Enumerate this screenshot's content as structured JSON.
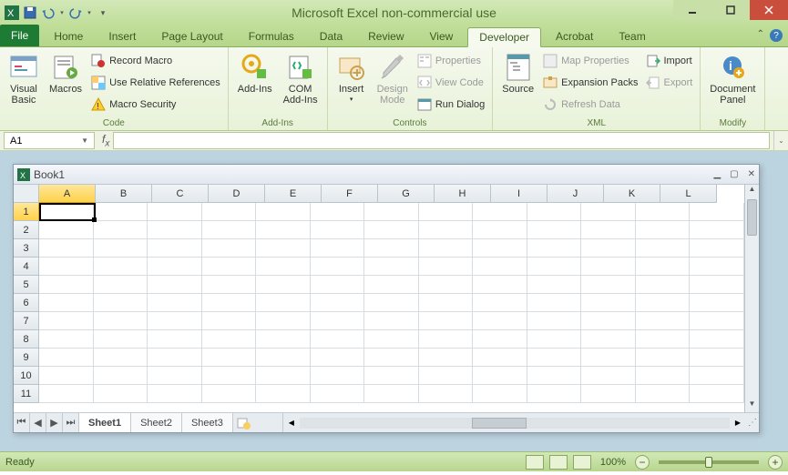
{
  "title": "Microsoft Excel non-commercial use",
  "tabs": {
    "file": "File",
    "home": "Home",
    "insert": "Insert",
    "pagelayout": "Page Layout",
    "formulas": "Formulas",
    "data": "Data",
    "review": "Review",
    "view": "View",
    "developer": "Developer",
    "acrobat": "Acrobat",
    "team": "Team"
  },
  "ribbon": {
    "code": {
      "visual_basic": "Visual\nBasic",
      "macros": "Macros",
      "record_macro": "Record Macro",
      "use_relative": "Use Relative References",
      "macro_security": "Macro Security",
      "group": "Code"
    },
    "addins": {
      "addins": "Add-Ins",
      "com_addins": "COM\nAdd-Ins",
      "group": "Add-Ins"
    },
    "controls": {
      "insert": "Insert",
      "design_mode": "Design\nMode",
      "properties": "Properties",
      "view_code": "View Code",
      "run_dialog": "Run Dialog",
      "group": "Controls"
    },
    "xml": {
      "source": "Source",
      "map_properties": "Map Properties",
      "expansion_packs": "Expansion Packs",
      "refresh_data": "Refresh Data",
      "import": "Import",
      "export": "Export",
      "group": "XML"
    },
    "modify": {
      "document_panel": "Document\nPanel",
      "group": "Modify"
    }
  },
  "namebox": "A1",
  "workbook": {
    "title": "Book1",
    "columns": [
      "A",
      "B",
      "C",
      "D",
      "E",
      "F",
      "G",
      "H",
      "I",
      "J",
      "K",
      "L"
    ],
    "rows": [
      "1",
      "2",
      "3",
      "4",
      "5",
      "6",
      "7",
      "8",
      "9",
      "10",
      "11"
    ],
    "active_col": "A",
    "active_row": "1",
    "sheets": {
      "s1": "Sheet1",
      "s2": "Sheet2",
      "s3": "Sheet3"
    },
    "active_sheet": "Sheet1"
  },
  "status": {
    "ready": "Ready",
    "zoom": "100%"
  }
}
